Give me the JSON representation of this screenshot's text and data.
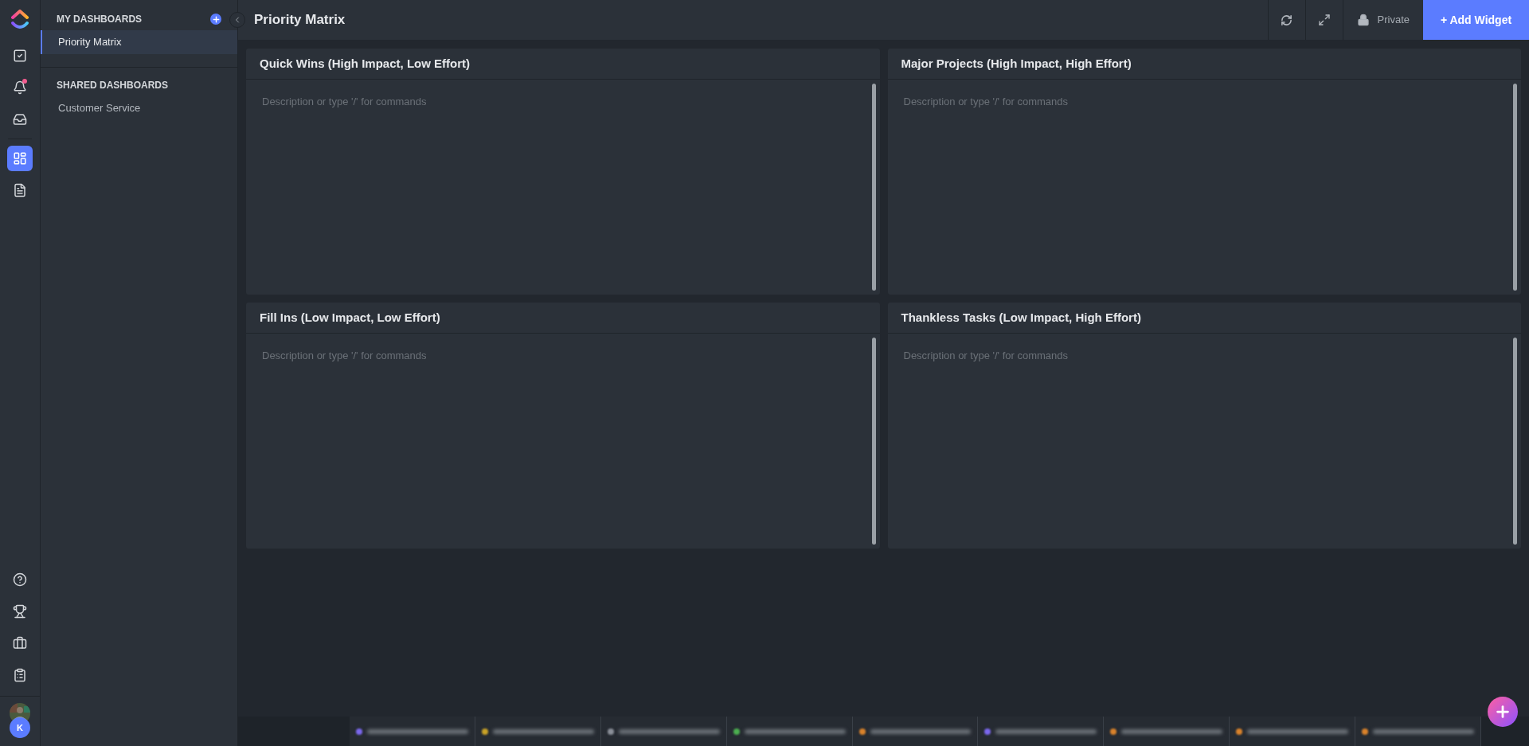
{
  "rail": {
    "top": [
      {
        "selected": false,
        "notification": false
      },
      {
        "selected": false,
        "notification": true
      },
      {
        "selected": false,
        "notification": false
      },
      {
        "selected": true,
        "notification": false
      },
      {
        "selected": false,
        "notification": false
      }
    ],
    "bottom": [
      {
        "selected": false
      },
      {
        "selected": false
      },
      {
        "selected": false
      },
      {
        "selected": false
      }
    ],
    "avatar_initial": "K"
  },
  "sidebar": {
    "sections": [
      {
        "title": "MY DASHBOARDS",
        "items": [
          {
            "label": "Priority Matrix",
            "selected": true
          }
        ]
      },
      {
        "title": "SHARED DASHBOARDS",
        "items": [
          {
            "label": "Customer Service",
            "selected": false
          }
        ]
      }
    ]
  },
  "header": {
    "title": "Priority Matrix",
    "privacy": "Private",
    "add_button": "+ Add Widget"
  },
  "widgets": [
    {
      "title": "Quick Wins (High Impact, Low Effort)",
      "placeholder": "Description or type '/' for commands"
    },
    {
      "title": "Major Projects (High Impact, High Effort)",
      "placeholder": "Description or type '/' for commands"
    },
    {
      "title": "Fill Ins (Low Impact, Low Effort)",
      "placeholder": "Description or type '/' for commands"
    },
    {
      "title": "Thankless Tasks (Low Impact, High Effort)",
      "placeholder": "Description or type '/' for commands"
    }
  ],
  "tray": [
    {
      "color": "#7b68ee"
    },
    {
      "color": "#c9a227"
    },
    {
      "color": "#8a8f98"
    },
    {
      "color": "#4caf50"
    },
    {
      "color": "#d9822b"
    },
    {
      "color": "#7b68ee"
    },
    {
      "color": "#d9822b"
    },
    {
      "color": "#d9822b"
    },
    {
      "color": "#d9822b"
    }
  ]
}
